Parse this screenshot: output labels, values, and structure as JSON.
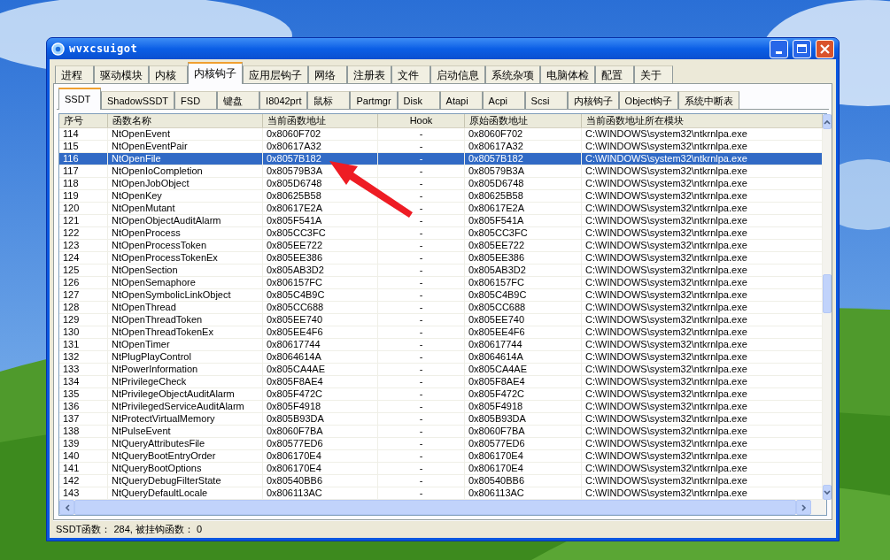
{
  "window": {
    "title": "wvxcsuigot"
  },
  "main_tabs": [
    {
      "label": "进程",
      "selected": false
    },
    {
      "label": "驱动模块",
      "selected": false
    },
    {
      "label": "内核",
      "selected": false
    },
    {
      "label": "内核钩子",
      "selected": true
    },
    {
      "label": "应用层钩子",
      "selected": false
    },
    {
      "label": "网络",
      "selected": false
    },
    {
      "label": "注册表",
      "selected": false
    },
    {
      "label": "文件",
      "selected": false
    },
    {
      "label": "启动信息",
      "selected": false
    },
    {
      "label": "系统杂项",
      "selected": false
    },
    {
      "label": "电脑体检",
      "selected": false
    },
    {
      "label": "配置",
      "selected": false
    },
    {
      "label": "关于",
      "selected": false
    }
  ],
  "sub_tabs": [
    {
      "label": "SSDT",
      "selected": true
    },
    {
      "label": "ShadowSSDT",
      "selected": false
    },
    {
      "label": "FSD",
      "selected": false
    },
    {
      "label": "键盘",
      "selected": false
    },
    {
      "label": "I8042prt",
      "selected": false
    },
    {
      "label": "鼠标",
      "selected": false
    },
    {
      "label": "Partmgr",
      "selected": false
    },
    {
      "label": "Disk",
      "selected": false
    },
    {
      "label": "Atapi",
      "selected": false
    },
    {
      "label": "Acpi",
      "selected": false
    },
    {
      "label": "Scsi",
      "selected": false
    },
    {
      "label": "内核钩子",
      "selected": false
    },
    {
      "label": "Object钩子",
      "selected": false
    },
    {
      "label": "系统中断表",
      "selected": false
    }
  ],
  "table": {
    "columns": [
      "序号",
      "函数名称",
      "当前函数地址",
      "Hook",
      "原始函数地址",
      "当前函数地址所在模块"
    ],
    "rows": [
      {
        "cells": [
          "114",
          "NtOpenEvent",
          "0x8060F702",
          "-",
          "0x8060F702",
          "C:\\WINDOWS\\system32\\ntkrnlpa.exe"
        ],
        "selected": false
      },
      {
        "cells": [
          "115",
          "NtOpenEventPair",
          "0x80617A32",
          "-",
          "0x80617A32",
          "C:\\WINDOWS\\system32\\ntkrnlpa.exe"
        ],
        "selected": false
      },
      {
        "cells": [
          "116",
          "NtOpenFile",
          "0x8057B182",
          "-",
          "0x8057B182",
          "C:\\WINDOWS\\system32\\ntkrnlpa.exe"
        ],
        "selected": true
      },
      {
        "cells": [
          "117",
          "NtOpenIoCompletion",
          "0x80579B3A",
          "-",
          "0x80579B3A",
          "C:\\WINDOWS\\system32\\ntkrnlpa.exe"
        ],
        "selected": false
      },
      {
        "cells": [
          "118",
          "NtOpenJobObject",
          "0x805D6748",
          "-",
          "0x805D6748",
          "C:\\WINDOWS\\system32\\ntkrnlpa.exe"
        ],
        "selected": false
      },
      {
        "cells": [
          "119",
          "NtOpenKey",
          "0x80625B58",
          "-",
          "0x80625B58",
          "C:\\WINDOWS\\system32\\ntkrnlpa.exe"
        ],
        "selected": false
      },
      {
        "cells": [
          "120",
          "NtOpenMutant",
          "0x80617E2A",
          "-",
          "0x80617E2A",
          "C:\\WINDOWS\\system32\\ntkrnlpa.exe"
        ],
        "selected": false
      },
      {
        "cells": [
          "121",
          "NtOpenObjectAuditAlarm",
          "0x805F541A",
          "-",
          "0x805F541A",
          "C:\\WINDOWS\\system32\\ntkrnlpa.exe"
        ],
        "selected": false
      },
      {
        "cells": [
          "122",
          "NtOpenProcess",
          "0x805CC3FC",
          "-",
          "0x805CC3FC",
          "C:\\WINDOWS\\system32\\ntkrnlpa.exe"
        ],
        "selected": false
      },
      {
        "cells": [
          "123",
          "NtOpenProcessToken",
          "0x805EE722",
          "-",
          "0x805EE722",
          "C:\\WINDOWS\\system32\\ntkrnlpa.exe"
        ],
        "selected": false
      },
      {
        "cells": [
          "124",
          "NtOpenProcessTokenEx",
          "0x805EE386",
          "-",
          "0x805EE386",
          "C:\\WINDOWS\\system32\\ntkrnlpa.exe"
        ],
        "selected": false
      },
      {
        "cells": [
          "125",
          "NtOpenSection",
          "0x805AB3D2",
          "-",
          "0x805AB3D2",
          "C:\\WINDOWS\\system32\\ntkrnlpa.exe"
        ],
        "selected": false
      },
      {
        "cells": [
          "126",
          "NtOpenSemaphore",
          "0x806157FC",
          "-",
          "0x806157FC",
          "C:\\WINDOWS\\system32\\ntkrnlpa.exe"
        ],
        "selected": false
      },
      {
        "cells": [
          "127",
          "NtOpenSymbolicLinkObject",
          "0x805C4B9C",
          "-",
          "0x805C4B9C",
          "C:\\WINDOWS\\system32\\ntkrnlpa.exe"
        ],
        "selected": false
      },
      {
        "cells": [
          "128",
          "NtOpenThread",
          "0x805CC688",
          "-",
          "0x805CC688",
          "C:\\WINDOWS\\system32\\ntkrnlpa.exe"
        ],
        "selected": false
      },
      {
        "cells": [
          "129",
          "NtOpenThreadToken",
          "0x805EE740",
          "-",
          "0x805EE740",
          "C:\\WINDOWS\\system32\\ntkrnlpa.exe"
        ],
        "selected": false
      },
      {
        "cells": [
          "130",
          "NtOpenThreadTokenEx",
          "0x805EE4F6",
          "-",
          "0x805EE4F6",
          "C:\\WINDOWS\\system32\\ntkrnlpa.exe"
        ],
        "selected": false
      },
      {
        "cells": [
          "131",
          "NtOpenTimer",
          "0x80617744",
          "-",
          "0x80617744",
          "C:\\WINDOWS\\system32\\ntkrnlpa.exe"
        ],
        "selected": false
      },
      {
        "cells": [
          "132",
          "NtPlugPlayControl",
          "0x8064614A",
          "-",
          "0x8064614A",
          "C:\\WINDOWS\\system32\\ntkrnlpa.exe"
        ],
        "selected": false
      },
      {
        "cells": [
          "133",
          "NtPowerInformation",
          "0x805CA4AE",
          "-",
          "0x805CA4AE",
          "C:\\WINDOWS\\system32\\ntkrnlpa.exe"
        ],
        "selected": false
      },
      {
        "cells": [
          "134",
          "NtPrivilegeCheck",
          "0x805F8AE4",
          "-",
          "0x805F8AE4",
          "C:\\WINDOWS\\system32\\ntkrnlpa.exe"
        ],
        "selected": false
      },
      {
        "cells": [
          "135",
          "NtPrivilegeObjectAuditAlarm",
          "0x805F472C",
          "-",
          "0x805F472C",
          "C:\\WINDOWS\\system32\\ntkrnlpa.exe"
        ],
        "selected": false
      },
      {
        "cells": [
          "136",
          "NtPrivilegedServiceAuditAlarm",
          "0x805F4918",
          "-",
          "0x805F4918",
          "C:\\WINDOWS\\system32\\ntkrnlpa.exe"
        ],
        "selected": false
      },
      {
        "cells": [
          "137",
          "NtProtectVirtualMemory",
          "0x805B93DA",
          "-",
          "0x805B93DA",
          "C:\\WINDOWS\\system32\\ntkrnlpa.exe"
        ],
        "selected": false
      },
      {
        "cells": [
          "138",
          "NtPulseEvent",
          "0x8060F7BA",
          "-",
          "0x8060F7BA",
          "C:\\WINDOWS\\system32\\ntkrnlpa.exe"
        ],
        "selected": false
      },
      {
        "cells": [
          "139",
          "NtQueryAttributesFile",
          "0x80577ED6",
          "-",
          "0x80577ED6",
          "C:\\WINDOWS\\system32\\ntkrnlpa.exe"
        ],
        "selected": false
      },
      {
        "cells": [
          "140",
          "NtQueryBootEntryOrder",
          "0x806170E4",
          "-",
          "0x806170E4",
          "C:\\WINDOWS\\system32\\ntkrnlpa.exe"
        ],
        "selected": false
      },
      {
        "cells": [
          "141",
          "NtQueryBootOptions",
          "0x806170E4",
          "-",
          "0x806170E4",
          "C:\\WINDOWS\\system32\\ntkrnlpa.exe"
        ],
        "selected": false
      },
      {
        "cells": [
          "142",
          "NtQueryDebugFilterState",
          "0x80540BB6",
          "-",
          "0x80540BB6",
          "C:\\WINDOWS\\system32\\ntkrnlpa.exe"
        ],
        "selected": false
      },
      {
        "cells": [
          "143",
          "NtQueryDefaultLocale",
          "0x806113AC",
          "-",
          "0x806113AC",
          "C:\\WINDOWS\\system32\\ntkrnlpa.exe"
        ],
        "selected": false
      }
    ]
  },
  "status_bar": "SSDT函数： 284, 被挂钩函数： 0"
}
